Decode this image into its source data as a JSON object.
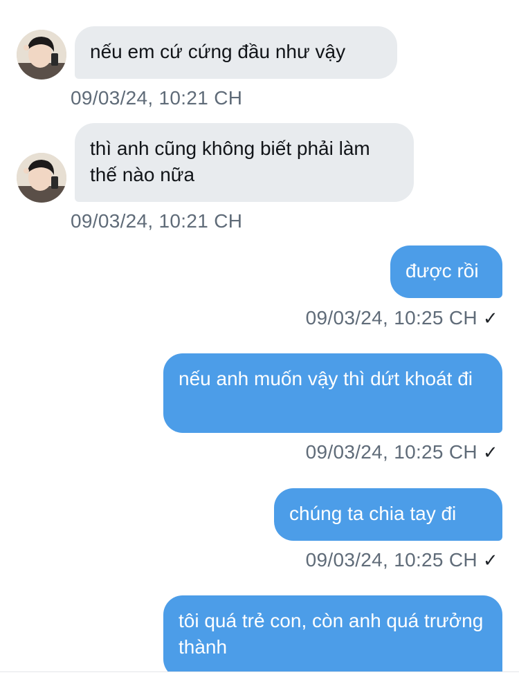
{
  "messages": [
    {
      "direction": "in",
      "text": "nếu em cứ cứng đầu như vậy",
      "time": "09/03/24, 10:21 CH"
    },
    {
      "direction": "in",
      "text": "thì anh cũng không biết phải làm thế nào nữa",
      "time": "09/03/24, 10:21 CH"
    },
    {
      "direction": "out",
      "text": "được rồi",
      "time": "09/03/24, 10:25 CH",
      "status": "✓"
    },
    {
      "direction": "out",
      "text": "nếu anh muốn vậy thì dứt khoát đi",
      "time": "09/03/24, 10:25 CH",
      "status": "✓"
    },
    {
      "direction": "out",
      "text": "chúng ta chia tay đi",
      "time": "09/03/24, 10:25 CH",
      "status": "✓"
    },
    {
      "direction": "out",
      "text": "tôi quá trẻ con, còn anh quá trưởng thành"
    }
  ],
  "colors": {
    "incoming_bubble": "#e8ebee",
    "outgoing_bubble": "#4c9de8",
    "timestamp": "#5f6b78"
  },
  "icons": {
    "avatar": "user-avatar-photo",
    "read_receipt": "checkmark-icon"
  }
}
